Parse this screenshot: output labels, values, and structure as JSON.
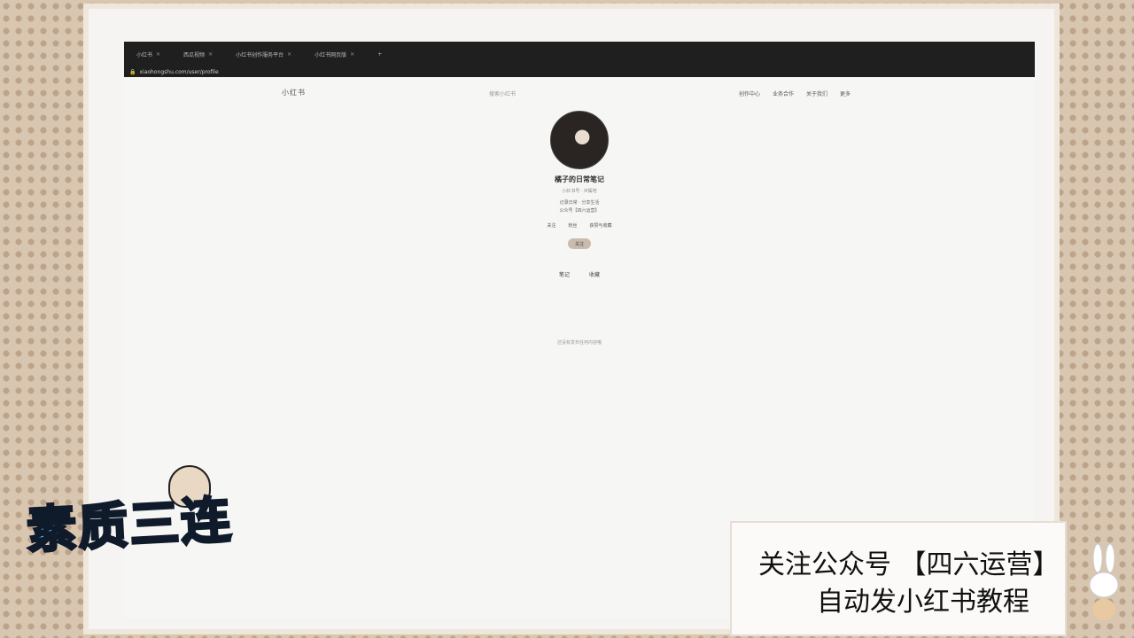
{
  "browser": {
    "tabs": [
      {
        "label": "小红书"
      },
      {
        "label": "西瓜视频"
      },
      {
        "label": "小红书创作服务平台"
      },
      {
        "label": "小红书网页版"
      }
    ],
    "address": "xiaohongshu.com/user/profile"
  },
  "site": {
    "logo": "小红书",
    "search_placeholder": "搜索小红书",
    "nav": [
      "创作中心",
      "业务合作",
      "关于我们",
      "更多"
    ]
  },
  "profile": {
    "nickname": "橘子的日常笔记",
    "meta": "小红书号 · IP属地",
    "bio_line1": "记录日常 · 分享生活",
    "bio_line2": "公众号【四六运营】",
    "tags": "",
    "stats": [
      {
        "value": "",
        "label": "关注"
      },
      {
        "value": "",
        "label": "粉丝"
      },
      {
        "value": "",
        "label": "获赞与收藏"
      }
    ],
    "follow_label": "关注"
  },
  "content_tabs": [
    "笔记",
    "收藏"
  ],
  "empty_text": "还没有发布任何内容哦",
  "overlay": {
    "line1": "关注公众号 【四六运营】",
    "line2": "自动发小红书教程"
  },
  "sticker_text": "素质三连"
}
